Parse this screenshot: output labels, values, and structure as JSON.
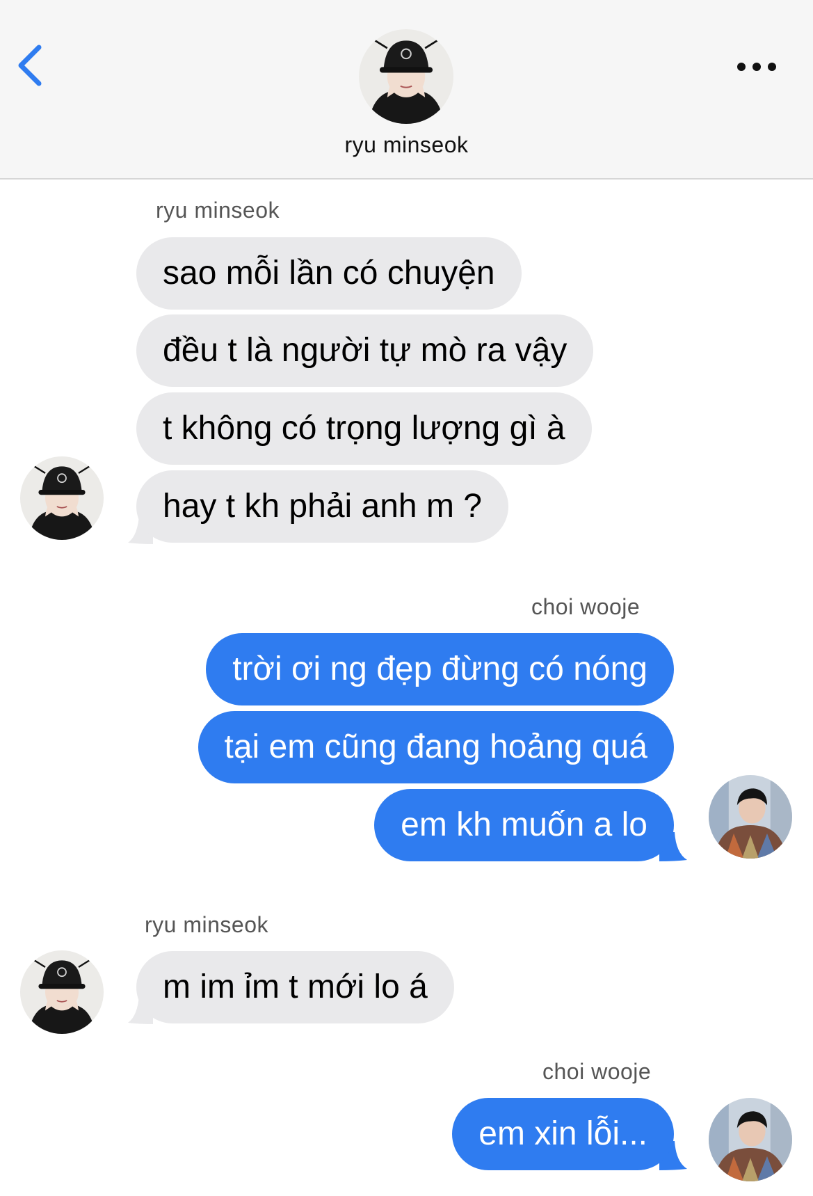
{
  "header": {
    "contact_name": "ryu minseok",
    "back_icon": "chevron-left-icon",
    "more_icon": "ellipsis-icon"
  },
  "colors": {
    "accent": "#2f7cf0",
    "received_bubble": "#e9e9eb",
    "header_bg": "#f6f6f6"
  },
  "messages": [
    {
      "sender": "ryu minseok",
      "direction": "received",
      "lines": [
        "sao mỗi lần có chuyện",
        "đều t là người tự mò ra vậy",
        "t không có trọng lượng gì à",
        "hay t kh phải anh m ?"
      ]
    },
    {
      "sender": "choi wooje",
      "direction": "sent",
      "lines": [
        "trời ơi ng đẹp đừng có nóng",
        "tại em cũng đang hoảng quá",
        "em kh muốn a lo"
      ]
    },
    {
      "sender": "ryu minseok",
      "direction": "received",
      "lines": [
        "m im ỉm t mới lo á"
      ]
    },
    {
      "sender": "choi wooje",
      "direction": "sent",
      "lines": [
        "em xin lỗi..."
      ]
    }
  ]
}
